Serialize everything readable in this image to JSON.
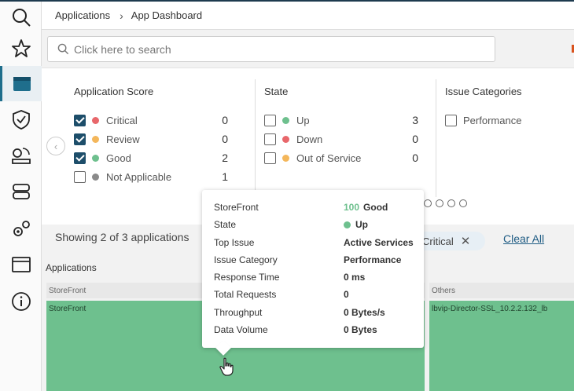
{
  "breadcrumb": {
    "parent": "Applications",
    "current": "App Dashboard"
  },
  "search": {
    "placeholder": "Click here to search"
  },
  "sidebar": {
    "items": [
      {
        "icon": "search-icon"
      },
      {
        "icon": "star-icon"
      },
      {
        "icon": "app-window-icon",
        "active": true
      },
      {
        "icon": "shield-check-icon"
      },
      {
        "icon": "network-icon"
      },
      {
        "icon": "server-icon"
      },
      {
        "icon": "settings-gears-icon"
      },
      {
        "icon": "window-icon"
      },
      {
        "icon": "info-icon"
      }
    ]
  },
  "filters": {
    "application_score": {
      "title": "Application Score",
      "items": [
        {
          "label": "Critical",
          "count": "0",
          "checked": true,
          "color": "#e8676b"
        },
        {
          "label": "Review",
          "count": "0",
          "checked": true,
          "color": "#f4b75b"
        },
        {
          "label": "Good",
          "count": "2",
          "checked": true,
          "color": "#6ec08e"
        },
        {
          "label": "Not Applicable",
          "count": "1",
          "checked": false,
          "color": "#8a8a8a"
        }
      ]
    },
    "state": {
      "title": "State",
      "items": [
        {
          "label": "Up",
          "count": "3",
          "checked": false,
          "color": "#6ec08e"
        },
        {
          "label": "Down",
          "count": "0",
          "checked": false,
          "color": "#e8676b"
        },
        {
          "label": "Out of Service",
          "count": "0",
          "checked": false,
          "color": "#f4b75b"
        }
      ]
    },
    "issue_categories": {
      "title": "Issue Categories",
      "items": [
        {
          "label": "Performance",
          "checked": false
        }
      ]
    }
  },
  "summary": {
    "showing": "Showing 2 of 3 applications",
    "chip_label": "Critical",
    "clear_all": "Clear All"
  },
  "applications": {
    "label": "Applications",
    "groups": [
      {
        "header": "StoreFront",
        "tile": "StoreFront"
      },
      {
        "header": "Others",
        "tile": "lbvip-Director-SSL_10.2.2.132_lb"
      }
    ]
  },
  "tooltip": {
    "rows": [
      {
        "label": "StoreFront",
        "value": "Good",
        "score": "100",
        "score_color": "#6ec08e"
      },
      {
        "label": "State",
        "value": "Up",
        "dot_color": "#6ec08e"
      },
      {
        "label": "Top Issue",
        "value": "Active Services"
      },
      {
        "label": "Issue Category",
        "value": "Performance"
      },
      {
        "label": "Response Time",
        "value": "0 ms"
      },
      {
        "label": "Total Requests",
        "value": "0"
      },
      {
        "label": "Throughput",
        "value": "0 Bytes/s"
      },
      {
        "label": "Data Volume",
        "value": "0 Bytes"
      }
    ]
  }
}
